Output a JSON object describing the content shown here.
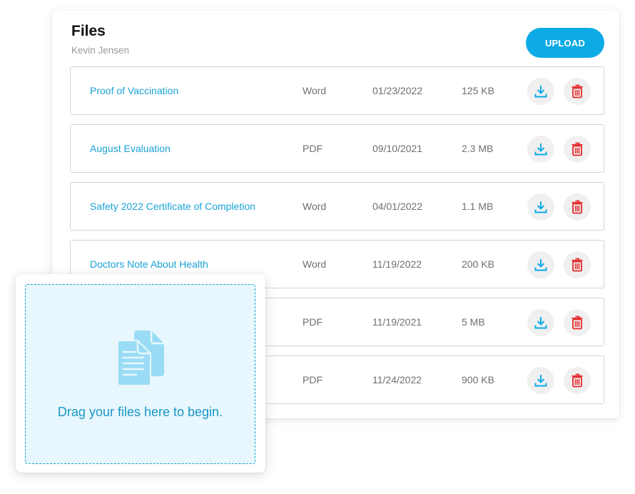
{
  "header": {
    "title": "Files",
    "subtitle": "Kevin Jensen",
    "upload_label": "UPLOAD"
  },
  "files": [
    {
      "name": "Proof of Vaccination",
      "type": "Word",
      "date": "01/23/2022",
      "size": "125 KB"
    },
    {
      "name": "August Evaluation",
      "type": "PDF",
      "date": "09/10/2021",
      "size": "2.3 MB"
    },
    {
      "name": "Safety 2022 Certificate of Completion",
      "type": "Word",
      "date": "04/01/2022",
      "size": "1.1 MB"
    },
    {
      "name": "Doctors Note About Health",
      "type": "Word",
      "date": "11/19/2022",
      "size": "200 KB"
    },
    {
      "name": "",
      "type": "PDF",
      "date": "11/19/2021",
      "size": "5 MB"
    },
    {
      "name": "",
      "type": "PDF",
      "date": "11/24/2022",
      "size": "900 KB"
    }
  ],
  "row_actions": {
    "download_icon": "download-icon",
    "delete_icon": "trash-icon"
  },
  "dropzone": {
    "icon": "documents-icon",
    "text": "Drag your files here to begin."
  },
  "colors": {
    "accent": "#0cabe6",
    "link": "#1aa3d6",
    "delete": "#e5282a",
    "dropzone_bg": "#e7f7fd",
    "dropzone_border": "#17a6cf"
  }
}
